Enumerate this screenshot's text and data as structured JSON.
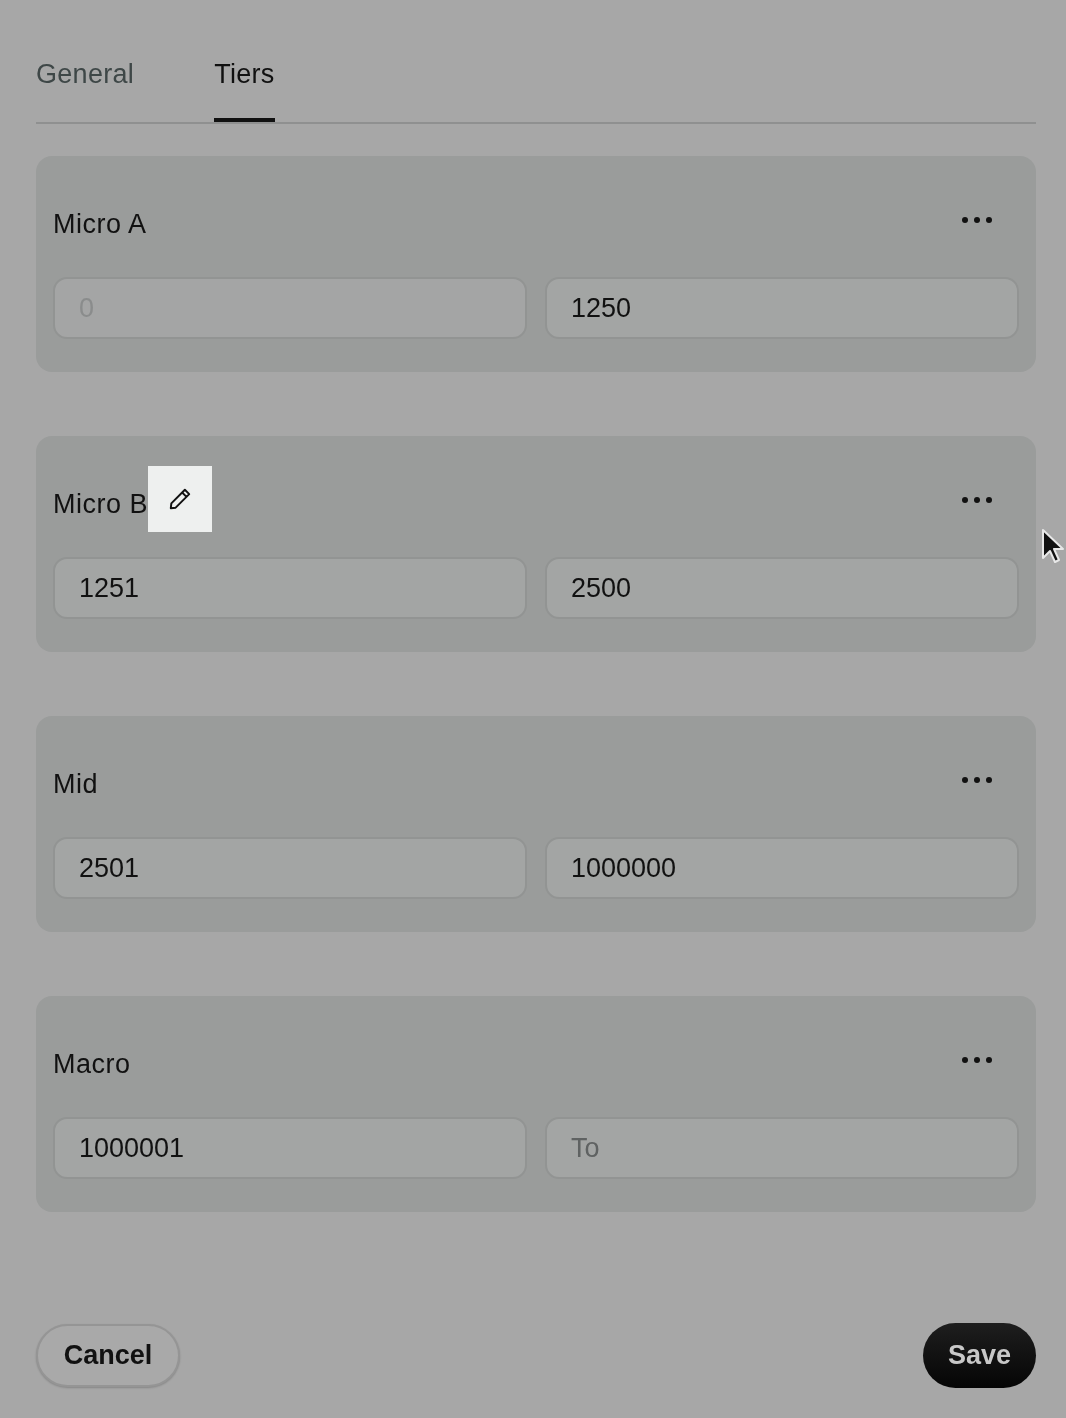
{
  "tabs": [
    {
      "label": "General",
      "selected": false
    },
    {
      "label": "Tiers",
      "selected": true
    }
  ],
  "tiers": [
    {
      "name": "Micro A",
      "edit_button_visible": false,
      "from": {
        "value": "0",
        "disabled": true
      },
      "to": {
        "value": "1250",
        "disabled": false
      }
    },
    {
      "name": "Micro B",
      "edit_button_visible": true,
      "from": {
        "value": "1251",
        "disabled": false
      },
      "to": {
        "value": "2500",
        "disabled": false
      }
    },
    {
      "name": "Mid",
      "edit_button_visible": false,
      "from": {
        "value": "2501",
        "disabled": false
      },
      "to": {
        "value": "1000000",
        "disabled": false
      }
    },
    {
      "name": "Macro",
      "edit_button_visible": false,
      "from": {
        "value": "1000001",
        "disabled": false
      },
      "to": {
        "placeholder": "To",
        "disabled": false
      }
    }
  ],
  "footer": {
    "cancel": "Cancel",
    "save": "Save"
  }
}
